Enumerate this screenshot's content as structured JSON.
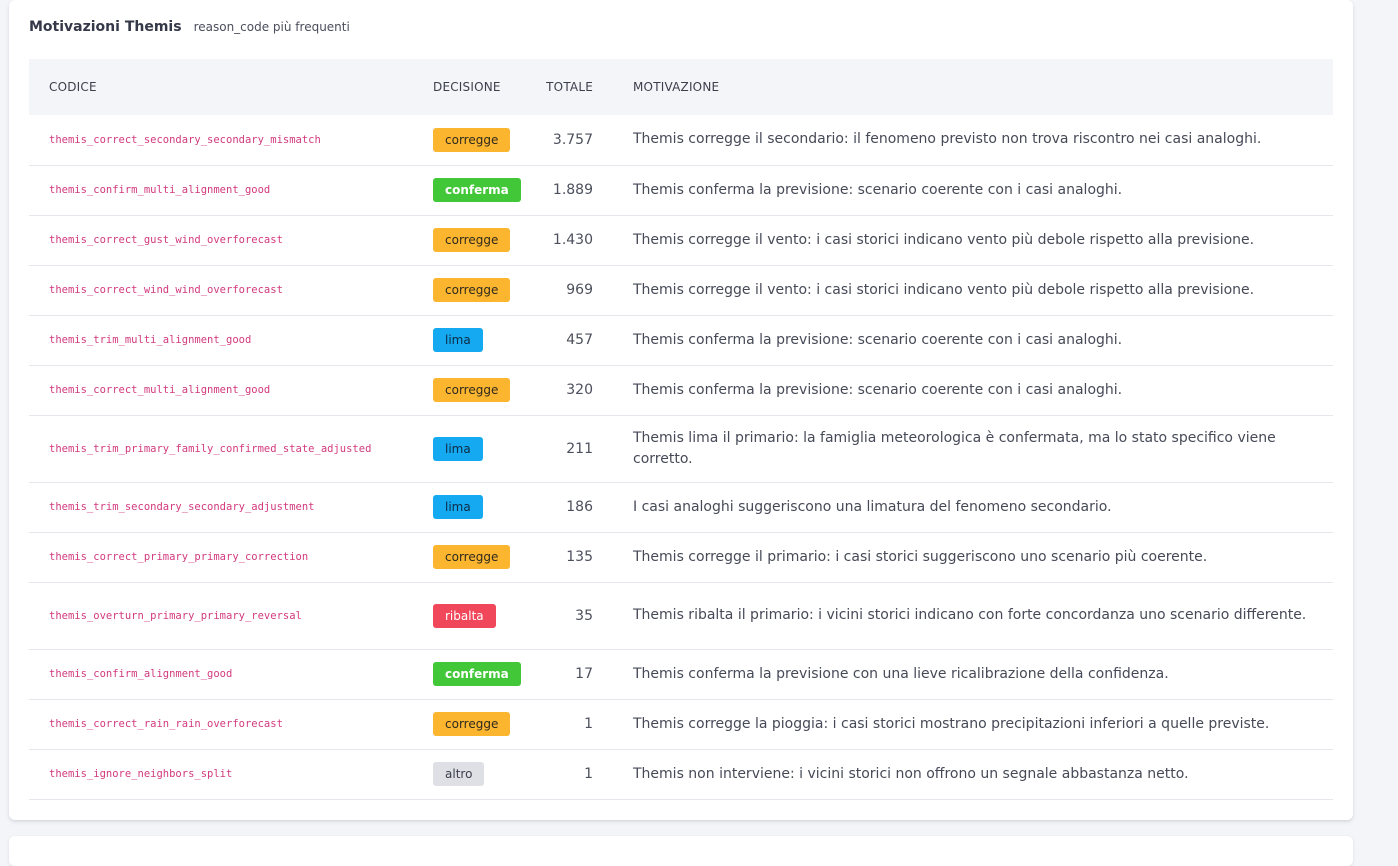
{
  "panel": {
    "title": "Motivazioni Themis",
    "subtitle": "reason_code più frequenti"
  },
  "table": {
    "columns": [
      "CODICE",
      "DECISIONE",
      "TOTALE",
      "MOTIVAZIONE"
    ],
    "rows": [
      {
        "code": "themis_correct_secondary_secondary_mismatch",
        "decision": "corregge",
        "total": "3.757",
        "reason": "Themis corregge il secondario: il fenomeno previsto non trova riscontro nei casi analoghi."
      },
      {
        "code": "themis_confirm_multi_alignment_good",
        "decision": "conferma",
        "total": "1.889",
        "reason": "Themis conferma la previsione: scenario coerente con i casi analoghi."
      },
      {
        "code": "themis_correct_gust_wind_overforecast",
        "decision": "corregge",
        "total": "1.430",
        "reason": "Themis corregge il vento: i casi storici indicano vento più debole rispetto alla previsione."
      },
      {
        "code": "themis_correct_wind_wind_overforecast",
        "decision": "corregge",
        "total": "969",
        "reason": "Themis corregge il vento: i casi storici indicano vento più debole rispetto alla previsione."
      },
      {
        "code": "themis_trim_multi_alignment_good",
        "decision": "lima",
        "total": "457",
        "reason": "Themis conferma la previsione: scenario coerente con i casi analoghi."
      },
      {
        "code": "themis_correct_multi_alignment_good",
        "decision": "corregge",
        "total": "320",
        "reason": "Themis conferma la previsione: scenario coerente con i casi analoghi."
      },
      {
        "code": "themis_trim_primary_family_confirmed_state_adjusted",
        "decision": "lima",
        "total": "211",
        "reason": "Themis lima il primario: la famiglia meteorologica è confermata, ma lo stato specifico viene corretto."
      },
      {
        "code": "themis_trim_secondary_secondary_adjustment",
        "decision": "lima",
        "total": "186",
        "reason": "I casi analoghi suggeriscono una limatura del fenomeno secondario."
      },
      {
        "code": "themis_correct_primary_primary_correction",
        "decision": "corregge",
        "total": "135",
        "reason": "Themis corregge il primario: i casi storici suggeriscono uno scenario più coerente."
      },
      {
        "code": "themis_overturn_primary_primary_reversal",
        "decision": "ribalta",
        "total": "35",
        "reason": "Themis ribalta il primario: i vicini storici indicano con forte concordanza uno scenario differente."
      },
      {
        "code": "themis_confirm_alignment_good",
        "decision": "conferma",
        "total": "17",
        "reason": "Themis conferma la previsione con una lieve ricalibrazione della confidenza."
      },
      {
        "code": "themis_correct_rain_rain_overforecast",
        "decision": "corregge",
        "total": "1",
        "reason": "Themis corregge la pioggia: i casi storici mostrano precipitazioni inferiori a quelle previste."
      },
      {
        "code": "themis_ignore_neighbors_split",
        "decision": "altro",
        "total": "1",
        "reason": "Themis non interviene: i vicini storici non offrono un segnale abbastanza netto."
      }
    ]
  },
  "colors": {
    "corregge": "#fbb52f",
    "conferma": "#42c738",
    "lima": "#14a9f0",
    "ribalta": "#f0475a",
    "altro": "#dfe0e5",
    "code_text": "#d23a7e"
  }
}
